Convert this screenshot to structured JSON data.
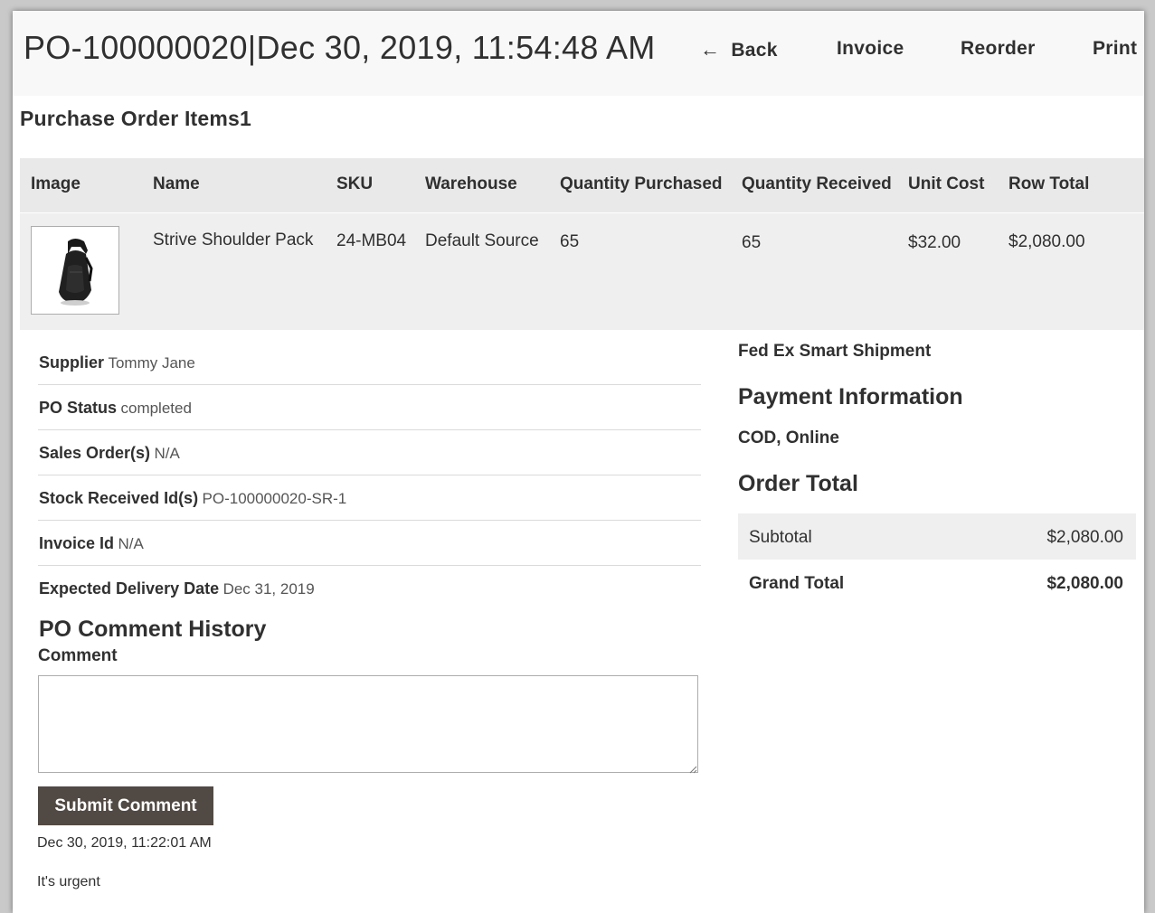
{
  "header": {
    "title": "PO-100000020|Dec 30, 2019, 11:54:48 AM",
    "actions": {
      "back": "Back",
      "invoice": "Invoice",
      "reorder": "Reorder",
      "print": "Print"
    }
  },
  "items_section": {
    "title": "Purchase Order Items1",
    "columns": [
      "Image",
      "Name",
      "SKU",
      "Warehouse",
      "Quantity Purchased",
      "Quantity Received",
      "Unit Cost",
      "Row Total"
    ],
    "rows": [
      {
        "image_icon": "backpack-thumbnail",
        "name": "Strive Shoulder Pack",
        "sku": "24-MB04",
        "warehouse": "Default Source",
        "qty_purchased": "65",
        "qty_received": "65",
        "unit_cost": "$32.00",
        "row_total": "$2,080.00"
      }
    ]
  },
  "po_info": {
    "supplier": {
      "label": "Supplier",
      "value": "Tommy Jane"
    },
    "status": {
      "label": "PO Status",
      "value": "completed"
    },
    "sales_orders": {
      "label": "Sales Order(s)",
      "value": "N/A"
    },
    "stock_received": {
      "label": "Stock Received Id(s)",
      "value": "PO-100000020-SR-1"
    },
    "invoice_id": {
      "label": "Invoice Id",
      "value": "N/A"
    },
    "expected_delivery": {
      "label": "Expected Delivery Date",
      "value": "Dec 31, 2019"
    }
  },
  "comments": {
    "title": "PO Comment History",
    "field_label": "Comment",
    "textarea_value": "",
    "submit_label": "Submit Comment",
    "history": [
      {
        "date": "Dec 30, 2019, 11:22:01 AM",
        "text": "It's urgent"
      }
    ]
  },
  "shipping": {
    "method": "Fed Ex Smart Shipment"
  },
  "payment": {
    "title": "Payment Information",
    "method": "COD, Online"
  },
  "order_total": {
    "title": "Order Total",
    "subtotal_label": "Subtotal",
    "subtotal_value": "$2,080.00",
    "grand_total_label": "Grand Total",
    "grand_total_value": "$2,080.00"
  },
  "colors": {
    "header_bg": "#f8f8f8",
    "table_bg": "#efefef",
    "button_bg": "#514943",
    "text": "#303030"
  }
}
